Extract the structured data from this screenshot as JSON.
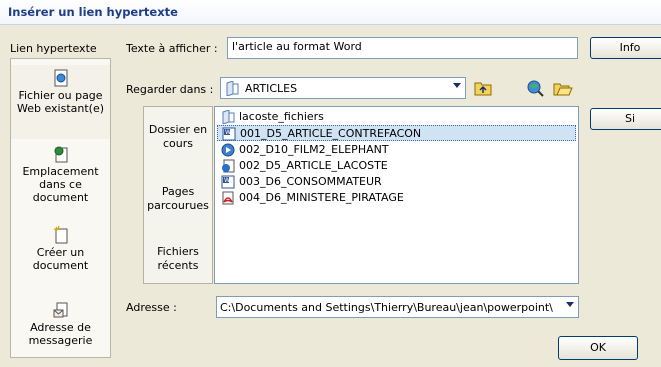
{
  "window": {
    "title": "Insérer un lien hypertexte"
  },
  "sidebar": {
    "label": "Lien hypertexte",
    "items": [
      {
        "label": "Fichier ou page Web existant(e)",
        "icon": "web-page-icon"
      },
      {
        "label": "Emplacement dans ce document",
        "icon": "document-location-icon"
      },
      {
        "label": "Créer un document",
        "icon": "new-document-icon"
      },
      {
        "label": "Adresse de messagerie",
        "icon": "email-icon"
      }
    ]
  },
  "text_to_display": {
    "label": "Texte à afficher :",
    "value": "l'article au format Word"
  },
  "look_in": {
    "label": "Regarder dans :",
    "value": "ARTICLES"
  },
  "buttons": {
    "screen_tip": "Info",
    "bookmark": "Si",
    "ok": "OK"
  },
  "tabs": [
    {
      "label": "Dossier en cours"
    },
    {
      "label": "Pages parcourues"
    },
    {
      "label": "Fichiers récents"
    }
  ],
  "files": [
    {
      "name": "lacoste_fichiers",
      "icon": "folder-icon",
      "selected": false
    },
    {
      "name": "001_D5_ARTICLE_CONTREFACON",
      "icon": "word-doc-icon",
      "selected": true
    },
    {
      "name": "002_D10_FILM2_ELEPHANT",
      "icon": "media-file-icon",
      "selected": false
    },
    {
      "name": "002_D5_ARTICLE_LACOSTE",
      "icon": "html-file-icon",
      "selected": false
    },
    {
      "name": "003_D6_CONSOMMATEUR",
      "icon": "word-doc-icon",
      "selected": false
    },
    {
      "name": "004_D6_MINISTERE_PIRATAGE",
      "icon": "pdf-file-icon",
      "selected": false
    }
  ],
  "address": {
    "label": "Adresse :",
    "value": "C:\\Documents and Settings\\Thierry\\Bureau\\jean\\powerpoint\\"
  }
}
